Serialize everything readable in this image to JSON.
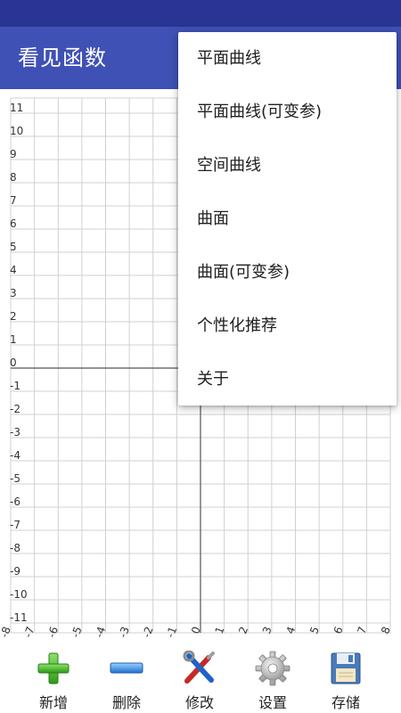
{
  "app": {
    "title": "看见函数"
  },
  "graph": {
    "x_ticks": [
      "-8",
      "-7",
      "-6",
      "-5",
      "-4",
      "-3",
      "-2",
      "-1",
      "0",
      "1",
      "2",
      "3",
      "4",
      "5",
      "6",
      "7",
      "8"
    ],
    "y_ticks": [
      "11",
      "10",
      "9",
      "8",
      "7",
      "6",
      "5",
      "4",
      "3",
      "2",
      "1",
      "0",
      "-1",
      "-2",
      "-3",
      "-4",
      "-5",
      "-6",
      "-7",
      "-8",
      "-9",
      "-10",
      "-11"
    ]
  },
  "menu": {
    "items": [
      "平面曲线",
      "平面曲线(可变参)",
      "空间曲线",
      "曲面",
      "曲面(可变参)",
      "个性化推荐",
      "关于"
    ]
  },
  "toolbar": {
    "add_label": "新增",
    "delete_label": "删除",
    "edit_label": "修改",
    "settings_label": "设置",
    "save_label": "存储"
  },
  "icons": {
    "add": "plus-icon",
    "delete": "minus-icon",
    "edit": "tools-icon",
    "settings": "gear-icon",
    "save": "floppy-disk-icon"
  },
  "colors": {
    "app_bar": "#3f51b5",
    "status_bar": "#283593",
    "grid_line": "#d0d0d0",
    "axis_line": "#555555"
  }
}
